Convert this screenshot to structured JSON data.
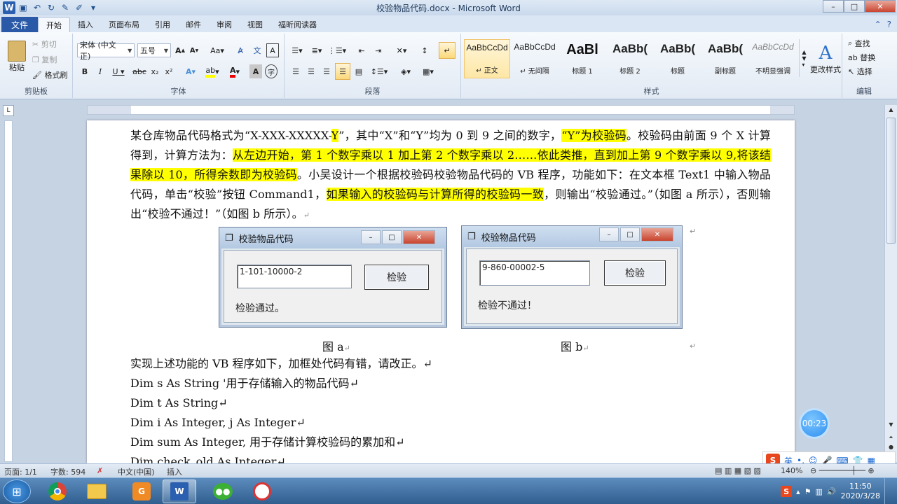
{
  "window": {
    "title": "校验物品代码.docx - Microsoft Word",
    "controls": {
      "minimize": "–",
      "maximize": "□",
      "close": "✕"
    }
  },
  "tabs": [
    "文件",
    "开始",
    "插入",
    "页面布局",
    "引用",
    "邮件",
    "审阅",
    "视图",
    "福昕阅读器"
  ],
  "ribbon": {
    "clipboard": {
      "label": "剪贴板",
      "paste": "粘贴",
      "cut": "剪切",
      "copy": "复制",
      "format_painter": "格式刷"
    },
    "font": {
      "label": "字体",
      "font_name": "宋体 (中文正)",
      "font_size": "五号"
    },
    "paragraph": {
      "label": "段落"
    },
    "styles": {
      "label": "样式",
      "items": [
        {
          "sample": "AaBbCcDd",
          "name": "↵ 正文"
        },
        {
          "sample": "AaBbCcDd",
          "name": "↵ 无间隔"
        },
        {
          "sample": "AaBl",
          "name": "标题 1"
        },
        {
          "sample": "AaBb(",
          "name": "标题 2"
        },
        {
          "sample": "AaBb(",
          "name": "标题"
        },
        {
          "sample": "AaBb(",
          "name": "副标题"
        },
        {
          "sample": "AaBbCcDd",
          "name": "不明显强调"
        }
      ],
      "change_styles": "更改样式"
    },
    "editing": {
      "label": "编辑",
      "find": "查找",
      "replace": "替换",
      "select": "选择"
    }
  },
  "document": {
    "para1": {
      "t1": "某仓库物品代码格式为“X-XXX-XXXXX-",
      "h1": "Y",
      "t2": "”，其中“X”和“Y”均为 0 到 9 之间的数字，",
      "h2": "“Y”为校验码",
      "t3": "。校验码由前面 9 个 X 计算得到，计算方法为：",
      "h3": "从左边开始，第 1 个数字乘以 1 加上第 2 个数字乘以 2……依此类推，直到加上第 9 个数字乘以 9,将该结果除以 10，所得余数即为校验码",
      "t4": "。小吴设计一个根据校验码校验物品代码的 VB 程序，功能如下：在文本框 Text1 中输入物品代码，单击“校验”按钮 Command1，",
      "h4": "如果输入的校验码与计算所得的校验码一致",
      "t5": "，则输出“校验通过。”（如图 a 所示），否则输出“校验不通过！”（如图 b 所示）。",
      "mark": "↵"
    },
    "figure_a": {
      "title": "校验物品代码",
      "input": "1-101-10000-2",
      "button": "检验",
      "result": "检验通过。",
      "caption": "图 a"
    },
    "figure_b": {
      "title": "校验物品代码",
      "input": "9-860-00002-5",
      "button": "检验",
      "result": "检验不通过！",
      "caption": "图 b"
    },
    "para2": "实现上述功能的 VB 程序如下，加框处代码有错，请改正。↵",
    "code": [
      "Dim s As String  '用于存储输入的物品代码↵",
      "Dim t As String↵",
      "Dim i As Integer, j As Integer↵",
      "Dim sum As Integer,  用于存储计算校验码的累加和↵",
      "Dim check_old As Integer↵"
    ]
  },
  "statusbar": {
    "page": "页面: 1/1",
    "words": "字数: 594",
    "language": "中文(中国)",
    "mode": "插入",
    "zoom": "140%"
  },
  "timer": "00:23",
  "ime": {
    "logo": "S",
    "lang": "英"
  },
  "taskbar": {
    "time": "11:50",
    "date": "2020/3/28"
  }
}
